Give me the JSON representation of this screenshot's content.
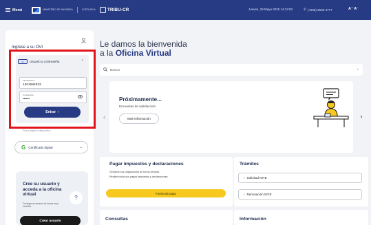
{
  "topbar": {
    "menu_label": "Menú",
    "logo_text_1": "MINISTERIO DE HACIENDA",
    "logo_text_2": "COSTA RICA",
    "brand": "TRIBU-CR",
    "datetime": "Jueves, 29 Mayo 2025 14:12:50",
    "phone": "(+506) 2539-4777",
    "font_size_controls": "A⁺ A⁻",
    "colors": {
      "bar": "#273a84",
      "accent": "#f7c81e",
      "highlight": "#e2121b"
    }
  },
  "login": {
    "title": "Ingrese a su OVI",
    "method_badge": "•• ",
    "method_label": "Usuario y contraseña",
    "id_label": "Identificación",
    "id_value": "1301584933",
    "password_label": "Contraseña",
    "password_value": "••••••",
    "submit_label": "Entrar",
    "hidden_option": "Firma digital o dispositivo",
    "cert_label": "Certificado digital"
  },
  "signup": {
    "title": "Cree su usuario y acceda a la oficina virtual",
    "subtitle": "Consiga su acceso de forma muy sencilla.",
    "help_icon": "question-icon",
    "button_label": "Crear usuario"
  },
  "main": {
    "welcome_line1": "Le damos la bienvenida",
    "welcome_prefix": "a la ",
    "welcome_strong": "Oficina Virtual",
    "search_placeholder": "Buscar"
  },
  "carousel": {
    "title": "Próximamente...",
    "subtitle": "Encuestas de satisfacción",
    "button_label": "Más información"
  },
  "pagar": {
    "title": "Pagar impuestos y declaraciones",
    "line1": "Gestione sus obligaciones de forma sencilla.",
    "line2": "Realice todos sus pagos impuestos y declaraciones.",
    "button_label": "Forma de pago"
  },
  "tramites": {
    "title": "Trámites",
    "items": [
      "Solicitud NITE",
      "Renovación NITE"
    ]
  },
  "consultas": {
    "title": "Consultas"
  },
  "informacion": {
    "title": "Información"
  }
}
